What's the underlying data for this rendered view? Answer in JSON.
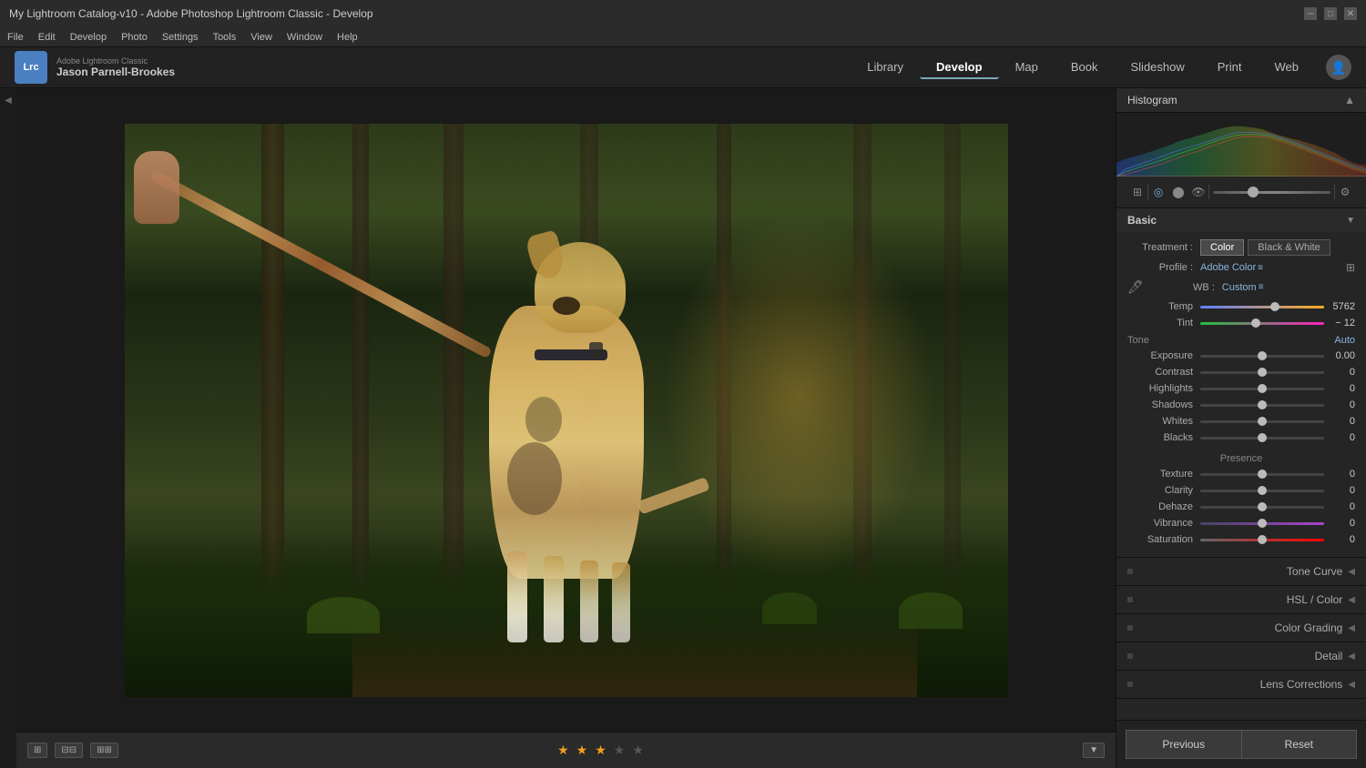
{
  "app": {
    "title": "My Lightroom Catalog-v10 - Adobe Photoshop Lightroom Classic - Develop",
    "logo": "Lrc",
    "app_name_top": "Adobe Lightroom Classic",
    "app_name_bottom": "Jason Parnell-Brookes"
  },
  "menu": {
    "items": [
      "File",
      "Edit",
      "Develop",
      "Photo",
      "Settings",
      "Tools",
      "View",
      "Window",
      "Help"
    ]
  },
  "nav": {
    "links": [
      "Library",
      "Develop",
      "Map",
      "Book",
      "Slideshow",
      "Print",
      "Web"
    ],
    "active": "Develop"
  },
  "toolbar": {
    "rating_stars": 3,
    "total_stars": 5
  },
  "right_panel": {
    "histogram_title": "Histogram",
    "tool_icons": [
      "grid",
      "crop",
      "spot",
      "redeye",
      "mask",
      "settings"
    ],
    "basic_title": "Basic",
    "treatment_label": "Treatment :",
    "treatment_color": "Color",
    "treatment_bw": "Black & White",
    "profile_label": "Profile :",
    "profile_value": "Adobe Color",
    "wb_label": "WB :",
    "wb_value": "Custom",
    "temp_label": "Temp",
    "temp_value": "5762",
    "tint_label": "Tint",
    "tint_value": "− 12",
    "tone_label": "Tone",
    "tone_auto": "Auto",
    "exposure_label": "Exposure",
    "exposure_value": "0.00",
    "contrast_label": "Contrast",
    "contrast_value": "0",
    "highlights_label": "Highlights",
    "highlights_value": "0",
    "shadows_label": "Shadows",
    "shadows_value": "0",
    "whites_label": "Whites",
    "whites_value": "0",
    "blacks_label": "Blacks",
    "blacks_value": "0",
    "presence_label": "Presence",
    "texture_label": "Texture",
    "texture_value": "0",
    "clarity_label": "Clarity",
    "clarity_value": "0",
    "dehaze_label": "Dehaze",
    "dehaze_value": "0",
    "vibrance_label": "Vibrance",
    "vibrance_value": "0",
    "saturation_label": "Saturation",
    "saturation_value": "0",
    "tone_curve_title": "Tone Curve",
    "hsl_title": "HSL / Color",
    "color_grading_title": "Color Grading",
    "detail_title": "Detail",
    "lens_corrections_title": "Lens Corrections",
    "previous_btn": "Previous",
    "reset_btn": "Reset"
  },
  "sliders": {
    "temp_pct": 60,
    "tint_pct": 45,
    "exposure_pct": 50,
    "contrast_pct": 50,
    "highlights_pct": 50,
    "shadows_pct": 50,
    "whites_pct": 50,
    "blacks_pct": 50,
    "texture_pct": 50,
    "clarity_pct": 50,
    "dehaze_pct": 50,
    "vibrance_pct": 50,
    "saturation_pct": 50
  }
}
